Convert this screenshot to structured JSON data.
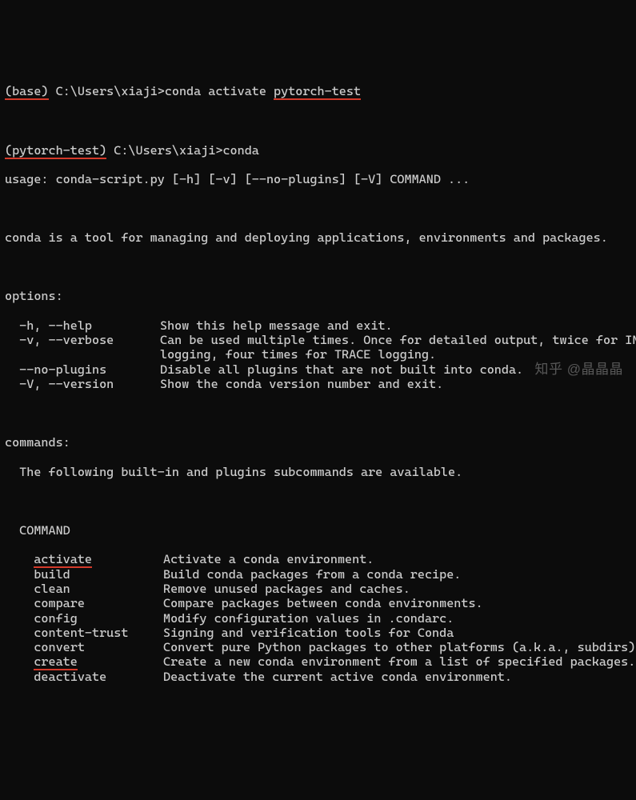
{
  "prompt1": {
    "env": "(base)",
    "path": " C:\\Users\\xiaji>",
    "cmd_prefix": "conda activate ",
    "cmd_arg": "pytorch-test"
  },
  "prompt2": {
    "env": "(pytorch-test)",
    "path": " C:\\Users\\xiaji>",
    "cmd": "conda"
  },
  "usage": "usage: conda-script.py [-h] [-v] [--no-plugins] [-V] COMMAND ...",
  "description": "conda is a tool for managing and deploying applications, environments and packages.",
  "options_header": "options:",
  "options": [
    {
      "flags": "  -h, --help",
      "desc": "Show this help message and exit."
    },
    {
      "flags": "  -v, --verbose",
      "desc": "Can be used multiple times. Once for detailed output, twice for INF"
    },
    {
      "flags": "",
      "desc": "logging, four times for TRACE logging."
    },
    {
      "flags": "  --no-plugins",
      "desc": "Disable all plugins that are not built into conda."
    },
    {
      "flags": "  -V, --version",
      "desc": "Show the conda version number and exit."
    }
  ],
  "commands_header": "commands:",
  "commands_intro": "  The following built-in and plugins subcommands are available.",
  "command_title": "  COMMAND",
  "commands": [
    {
      "name": "activate",
      "desc": "Activate a conda environment.",
      "ul": true
    },
    {
      "name": "build",
      "desc": "Build conda packages from a conda recipe."
    },
    {
      "name": "clean",
      "desc": "Remove unused packages and caches."
    },
    {
      "name": "compare",
      "desc": "Compare packages between conda environments."
    },
    {
      "name": "config",
      "desc": "Modify configuration values in .condarc."
    },
    {
      "name": "content-trust",
      "desc": "Signing and verification tools for Conda"
    },
    {
      "name": "convert",
      "desc": "Convert pure Python packages to other platforms (a.k.a., subdirs)."
    },
    {
      "name": "create",
      "desc": "Create a new conda environment from a list of specified packages.",
      "ul": true
    },
    {
      "name": "deactivate",
      "desc": "Deactivate the current active conda environment."
    }
  ],
  "watermark": "知乎 @晶晶晶"
}
